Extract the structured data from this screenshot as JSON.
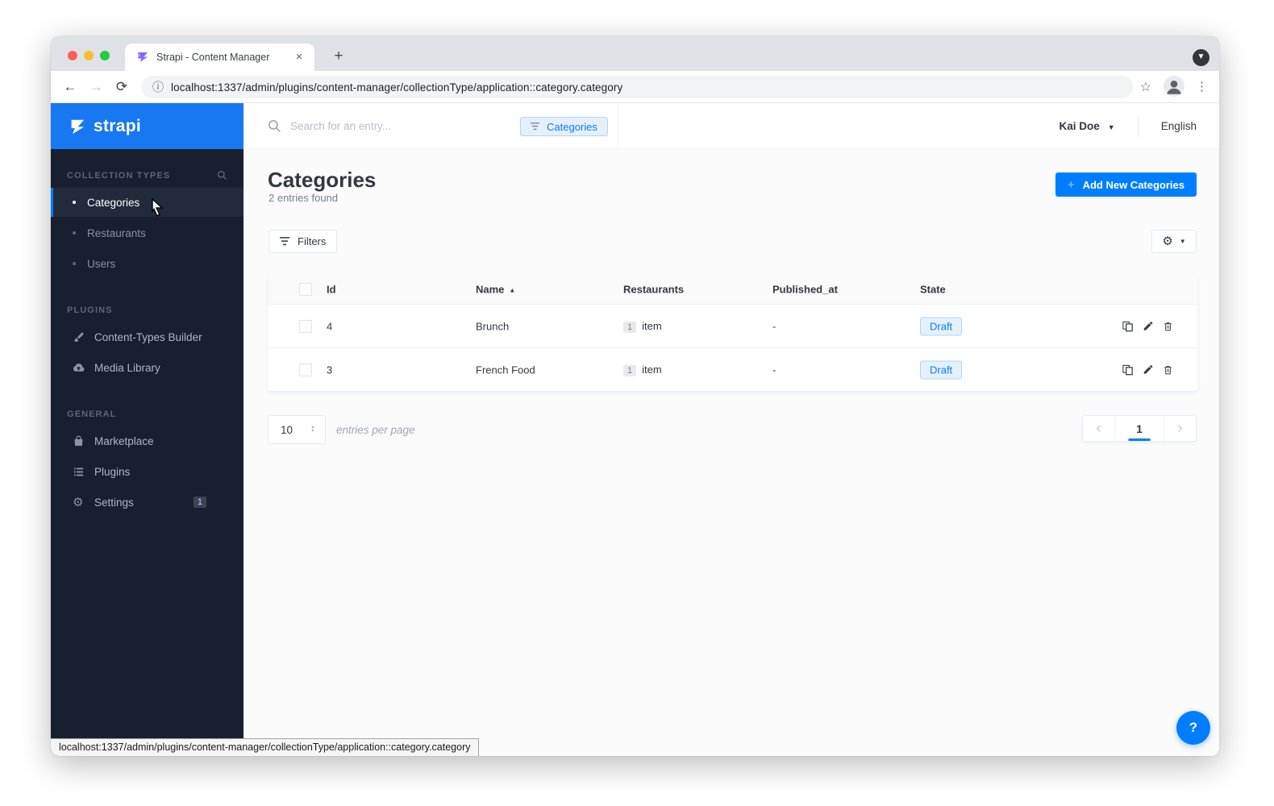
{
  "browser": {
    "tab_title": "Strapi - Content Manager",
    "tab_close_icon": "×",
    "new_tab_icon": "+",
    "url": "localhost:1337/admin/plugins/content-manager/collectionType/application::category.category",
    "status_url": "localhost:1337/admin/plugins/content-manager/collectionType/application::category.category"
  },
  "sidebar": {
    "logo_text": "strapi",
    "collection_types": {
      "label": "COLLECTION TYPES",
      "items": [
        {
          "label": "Categories"
        },
        {
          "label": "Restaurants"
        },
        {
          "label": "Users"
        }
      ]
    },
    "plugins_section": {
      "label": "PLUGINS",
      "items": [
        {
          "label": "Content-Types Builder",
          "icon": "brush-icon"
        },
        {
          "label": "Media Library",
          "icon": "cloud-upload-icon"
        }
      ]
    },
    "general_section": {
      "label": "GENERAL",
      "items": [
        {
          "label": "Marketplace",
          "icon": "shop-icon"
        },
        {
          "label": "Plugins",
          "icon": "list-icon"
        },
        {
          "label": "Settings",
          "icon": "gear-icon",
          "badge": "1"
        }
      ]
    }
  },
  "header": {
    "search_placeholder": "Search for an entry...",
    "filter_chip_label": "Categories",
    "user_name": "Kai Doe",
    "language": "English"
  },
  "page": {
    "title": "Categories",
    "subtitle": "2 entries found",
    "add_button_label": "Add New Categories",
    "add_button_plus": "+",
    "filters_button_label": "Filters"
  },
  "table": {
    "headers": [
      "Id",
      "Name",
      "Restaurants",
      "Published_at",
      "State"
    ],
    "sort_icon": "▲",
    "rows": [
      {
        "id": "4",
        "name": "Brunch",
        "count": "1",
        "count_label": "item",
        "published_at": "-",
        "state": "Draft"
      },
      {
        "id": "3",
        "name": "French Food",
        "count": "1",
        "count_label": "item",
        "published_at": "-",
        "state": "Draft"
      }
    ]
  },
  "pagination": {
    "per_page": "10",
    "per_page_label": "entries per page",
    "page": "1",
    "prev_icon": "‹",
    "next_icon": "›"
  },
  "help": {
    "label": "?"
  },
  "colors": {
    "accent_blue": "#007eff",
    "logo_blue": "#1778f2",
    "sidebar_bg": "#181f2e",
    "draft_bg": "#e6f0fb",
    "draft_border": "#aed4fb"
  }
}
